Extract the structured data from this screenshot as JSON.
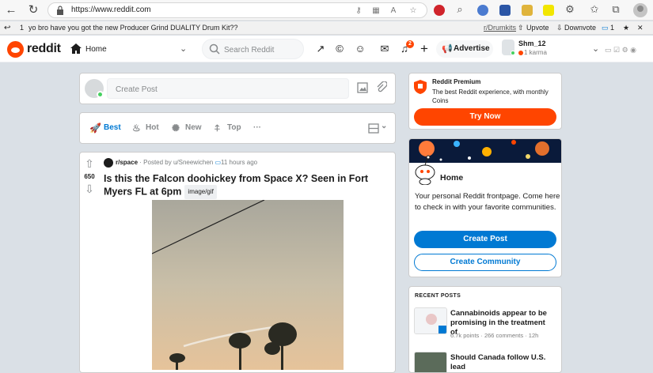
{
  "browser": {
    "url": "https://www.reddit.com"
  },
  "toolbar2": {
    "post_text": "yo bro have you got the new Producer Grind DUALITY Drum Kit??",
    "index": "1",
    "subreddit": "r/Drumkits",
    "upvote": "Upvote",
    "downvote": "Downvote",
    "comments": "1"
  },
  "header": {
    "brand": "reddit",
    "home": "Home",
    "search_placeholder": "Search Reddit",
    "notif_count": "2",
    "advertise": "Advertise",
    "username": "Shm_12",
    "karma": "1 karma"
  },
  "create_post": {
    "placeholder": "Create Post"
  },
  "sort": {
    "items": [
      "Best",
      "Hot",
      "New",
      "Top"
    ],
    "more": "···"
  },
  "post": {
    "subreddit": "r/space",
    "posted_by": "· Posted by u/Sneewichen",
    "time": "11 hours ago",
    "title": "Is this the Falcon doohickey from Space X? Seen in Fort Myers FL at 6pm",
    "flair": "image/gif",
    "score": "650"
  },
  "premium": {
    "title": "Reddit Premium",
    "desc": "The best Reddit experience, with monthly Coins",
    "button": "Try Now"
  },
  "home_card": {
    "title": "Home",
    "desc": "Your personal Reddit frontpage. Come here to check in with your favorite communities.",
    "create_post": "Create Post",
    "create_community": "Create Community"
  },
  "recent": {
    "heading": "RECENT POSTS",
    "items": [
      {
        "title": "Cannabinoids appear to be promising in the treatment of",
        "meta": "6.7k points · 266 comments · 12h"
      },
      {
        "title": "Should Canada follow U.S. lead",
        "meta": ""
      }
    ]
  },
  "colors": {
    "brand": "#ff4500",
    "primary": "#0079d3",
    "bg": "#dae0e6"
  }
}
